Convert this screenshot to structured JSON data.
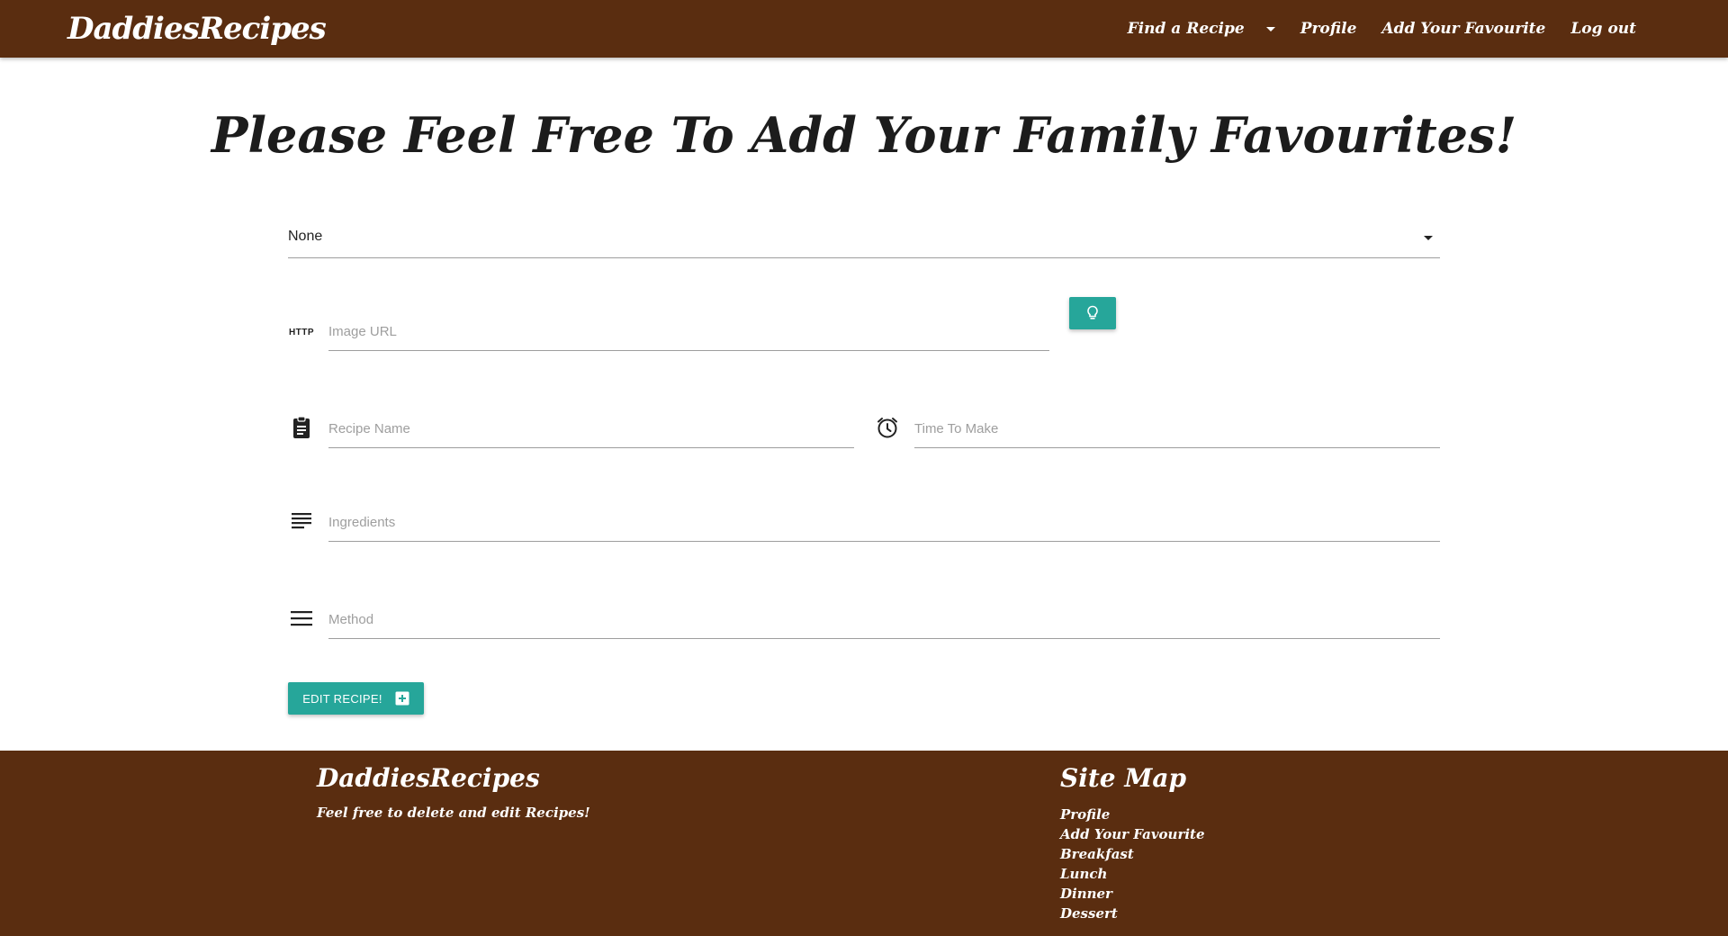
{
  "navbar": {
    "brand": "DaddiesRecipes",
    "links": {
      "find_recipe": "Find a Recipe",
      "profile": "Profile",
      "add_favourite": "Add Your Favourite",
      "logout": "Log out"
    },
    "color": "#5a2d10"
  },
  "main": {
    "title": "Please Feel Free To Add Your Family Favourites!",
    "category_select": {
      "value": "None"
    },
    "image_url": {
      "prefix_label": "HTTP",
      "placeholder": "Image URL",
      "value": ""
    },
    "recipe_name": {
      "placeholder": "Recipe Name",
      "value": "",
      "icon": "clipboard-icon"
    },
    "time_to_make": {
      "placeholder": "Time To Make",
      "value": "",
      "icon": "alarm-clock-icon"
    },
    "ingredients": {
      "placeholder": "Ingredients",
      "value": "",
      "icon": "subject-icon"
    },
    "method": {
      "placeholder": "Method",
      "value": "",
      "icon": "menu-lines-icon"
    },
    "preview_button_icon": "lightbulb-icon",
    "submit_label": "EDIT RECIPE!",
    "submit_icon": "add-box-icon",
    "accent": "#26a69a"
  },
  "footer": {
    "brand": "DaddiesRecipes",
    "tagline": "Feel free to delete and edit Recipes!",
    "sitemap_title": "Site Map",
    "sitemap_links": [
      "Profile",
      "Add Your Favourite",
      "Breakfast",
      "Lunch",
      "Dinner",
      "Dessert"
    ]
  }
}
